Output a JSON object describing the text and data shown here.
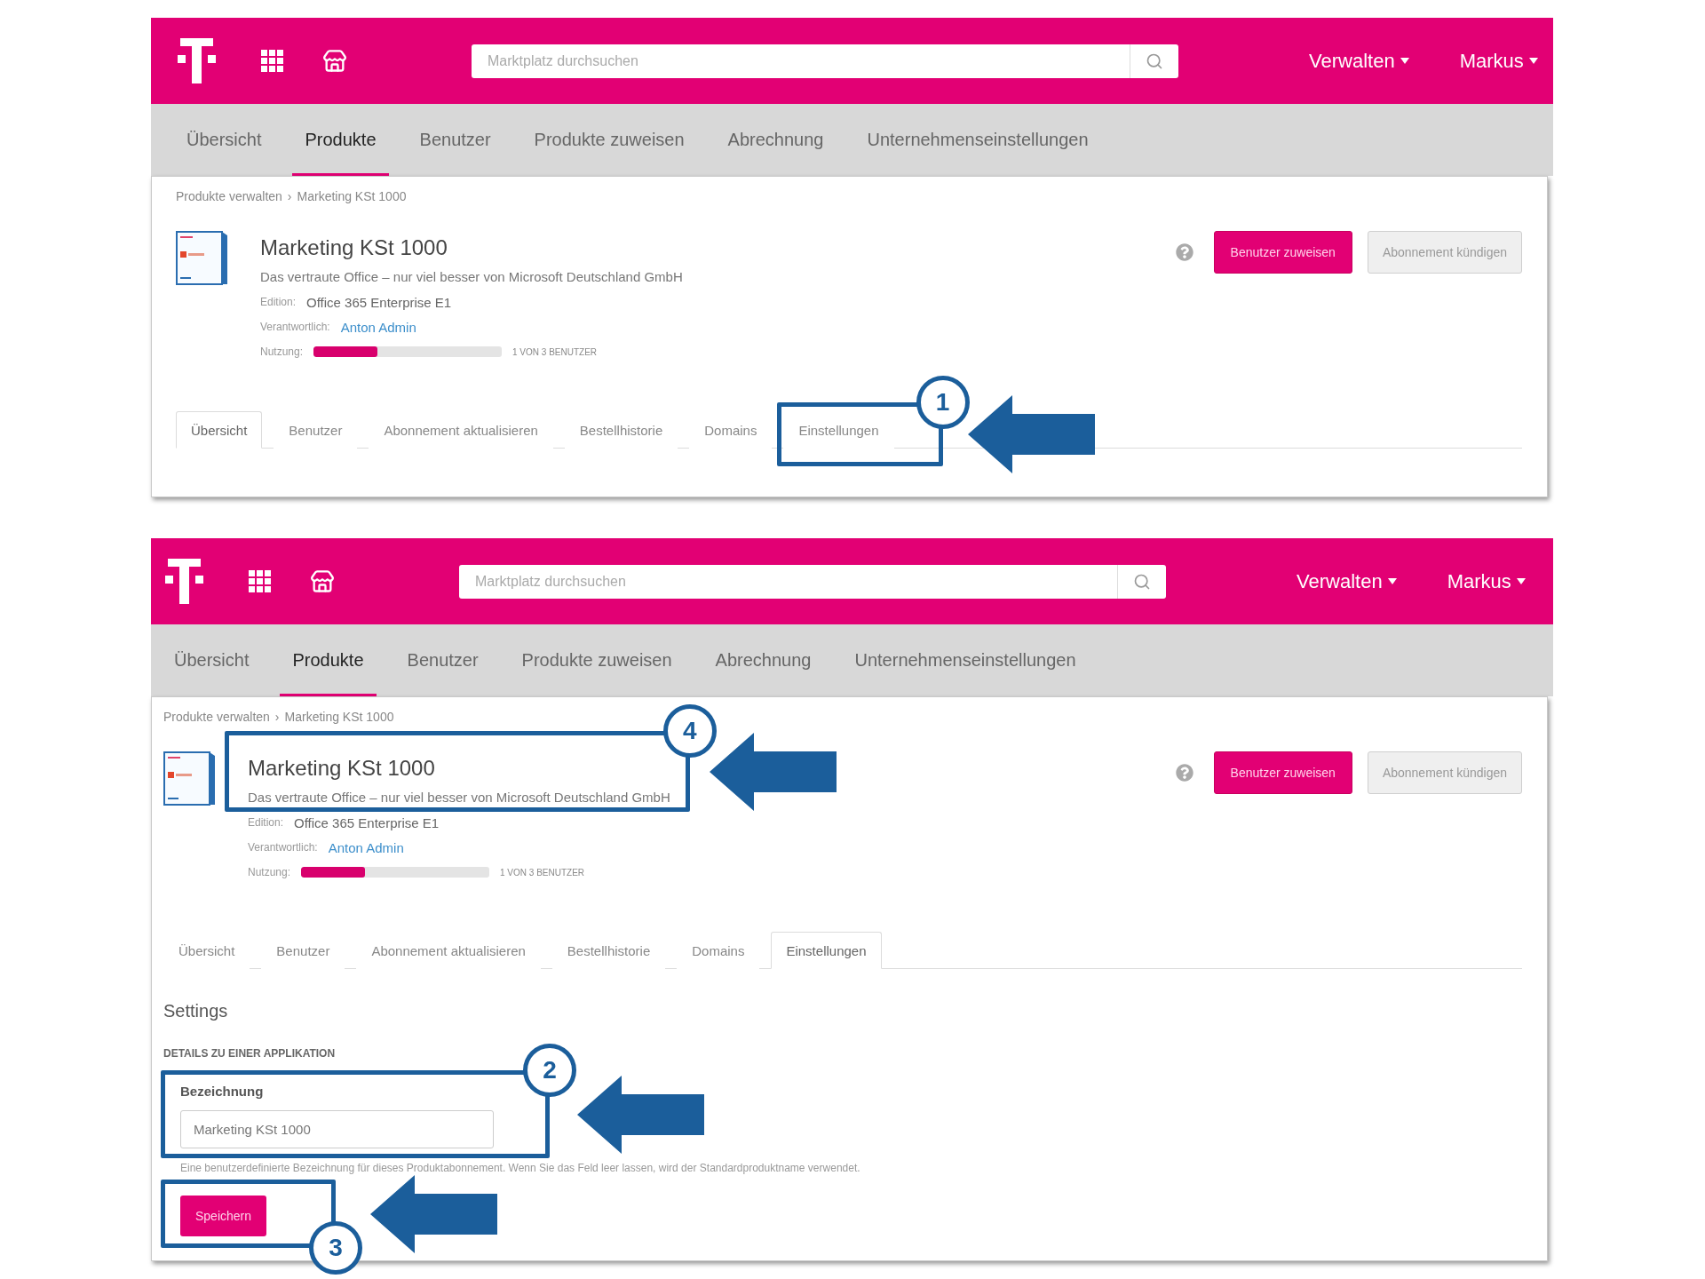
{
  "screenshots": [
    {
      "header": {
        "search": {
          "placeholder": "Marktplatz durchsuchen"
        },
        "menus": [
          {
            "label": "Verwalten"
          },
          {
            "label": "Markus"
          }
        ]
      },
      "nav": [
        {
          "label": "Übersicht",
          "selected": false
        },
        {
          "label": "Produkte",
          "selected": true
        },
        {
          "label": "Benutzer",
          "selected": false
        },
        {
          "label": "Produkte zuweisen",
          "selected": false
        },
        {
          "label": "Abrechnung",
          "selected": false
        },
        {
          "label": "Unternehmenseinstellungen",
          "selected": false
        }
      ],
      "breadcrumb": {
        "items": [
          "Produkte verwalten",
          "Marketing KSt 1000"
        ],
        "separator": "›"
      },
      "product": {
        "title": "Marketing KSt 1000",
        "description": "Das vertraute Office – nur viel besser von Microsoft Deutschland GmbH",
        "details": [
          {
            "kind": "text",
            "label": "Edition:",
            "value": "Office 365 Enterprise E1"
          },
          {
            "kind": "link",
            "label": "Verantwortlich:",
            "value": "Anton Admin"
          },
          {
            "kind": "meter",
            "label": "Nutzung:",
            "level": 0.34,
            "reading": "1 VON 3 BENUTZER"
          }
        ]
      },
      "actions": [
        {
          "kind": "primary",
          "label": "Benutzer zuweisen"
        },
        {
          "kind": "secondary",
          "label": "Abonnement kündigen"
        }
      ],
      "tabs": [
        {
          "label": "Übersicht",
          "selected": true
        },
        {
          "label": "Benutzer",
          "selected": false
        },
        {
          "label": "Abonnement aktualisieren",
          "selected": false
        },
        {
          "label": "Bestellhistorie",
          "selected": false
        },
        {
          "label": "Domains",
          "selected": false
        },
        {
          "label": "Einstellungen",
          "selected": false,
          "annotation": "1"
        }
      ]
    },
    {
      "header": {
        "search": {
          "placeholder": "Marktplatz durchsuchen"
        },
        "menus": [
          {
            "label": "Verwalten"
          },
          {
            "label": "Markus"
          }
        ]
      },
      "nav": [
        {
          "label": "Übersicht",
          "selected": false
        },
        {
          "label": "Produkte",
          "selected": true
        },
        {
          "label": "Benutzer",
          "selected": false
        },
        {
          "label": "Produkte zuweisen",
          "selected": false
        },
        {
          "label": "Abrechnung",
          "selected": false
        },
        {
          "label": "Unternehmenseinstellungen",
          "selected": false
        }
      ],
      "breadcrumb": {
        "items": [
          "Produkte verwalten",
          "Marketing KSt 1000"
        ],
        "separator": "›"
      },
      "product": {
        "title": "Marketing KSt 1000",
        "description": "Das vertraute Office – nur viel besser von Microsoft Deutschland GmbH",
        "annotation": "4",
        "details": [
          {
            "kind": "text",
            "label": "Edition:",
            "value": "Office 365 Enterprise E1"
          },
          {
            "kind": "link",
            "label": "Verantwortlich:",
            "value": "Anton Admin"
          },
          {
            "kind": "meter",
            "label": "Nutzung:",
            "level": 0.34,
            "reading": "1 VON 3 BENUTZER"
          }
        ]
      },
      "actions": [
        {
          "kind": "primary",
          "label": "Benutzer zuweisen"
        },
        {
          "kind": "secondary",
          "label": "Abonnement kündigen"
        }
      ],
      "tabs": [
        {
          "label": "Übersicht",
          "selected": false
        },
        {
          "label": "Benutzer",
          "selected": false
        },
        {
          "label": "Abonnement aktualisieren",
          "selected": false
        },
        {
          "label": "Bestellhistorie",
          "selected": false
        },
        {
          "label": "Domains",
          "selected": false
        },
        {
          "label": "Einstellungen",
          "selected": true
        }
      ],
      "settings": {
        "title": "Settings",
        "section": "DETAILS ZU EINER APPLIKATION",
        "field": {
          "label": "Bezeichnung",
          "value": "Marketing KSt 1000",
          "annotation": "2"
        },
        "hint": "Eine benutzerdefinierte Bezeichnung für dieses Produktabonnement. Wenn Sie das Feld leer lassen, wird der Standardproduktname verwendet.",
        "save": {
          "label": "Speichern",
          "annotation": "3"
        }
      }
    }
  ]
}
